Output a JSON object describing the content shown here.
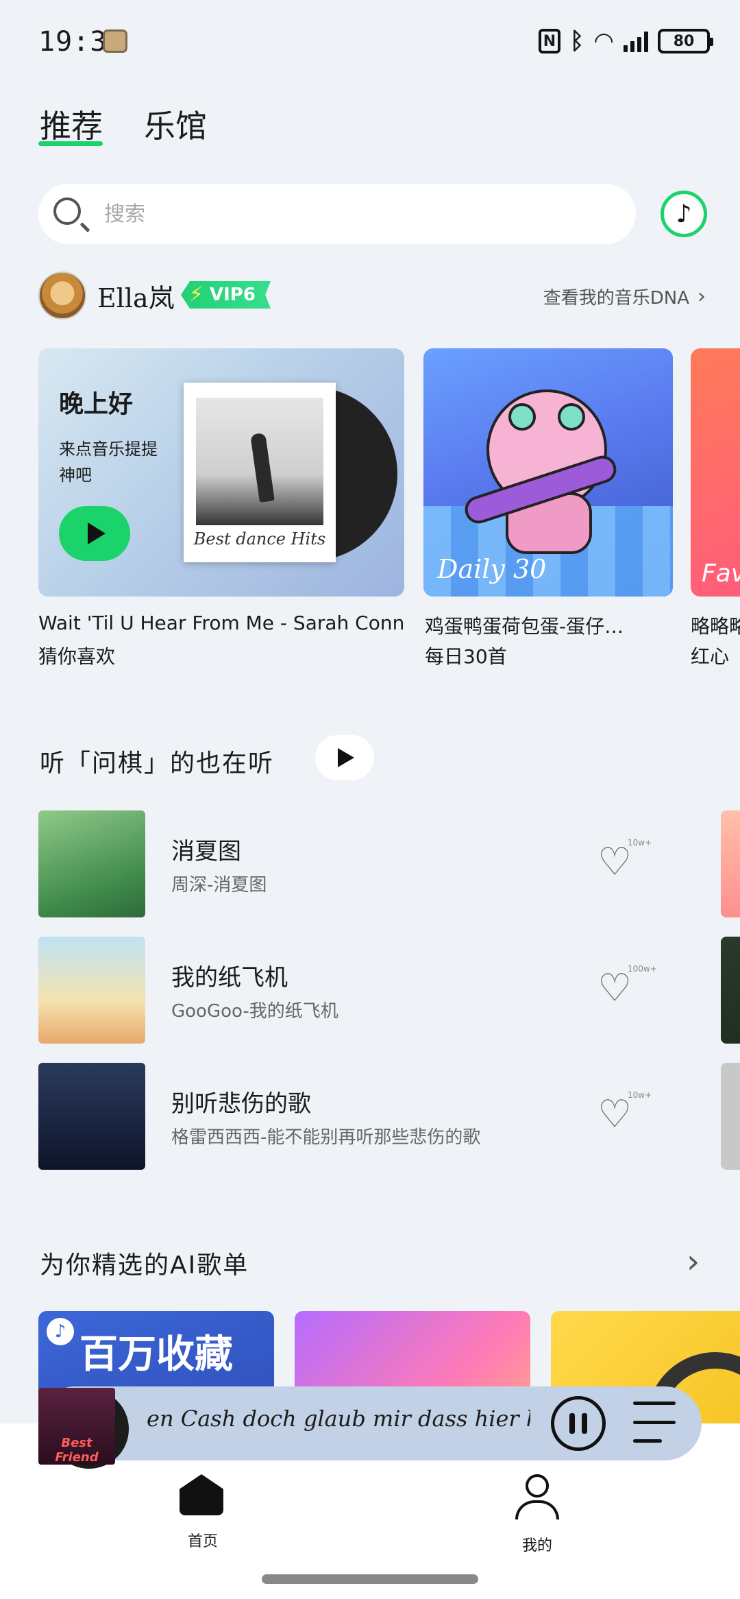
{
  "status_bar": {
    "time": "19:32",
    "battery": "80"
  },
  "tabs": [
    {
      "label": "推荐",
      "active": true
    },
    {
      "label": "乐馆",
      "active": false
    }
  ],
  "search": {
    "placeholder": "搜索"
  },
  "user": {
    "name": "Ella岚",
    "vip": "VIP6",
    "dna_link": "查看我的音乐DNA"
  },
  "cards": [
    {
      "greeting": "晚上好",
      "greeting_sub": "来点音乐提提神吧",
      "polaroid_caption": "Best dance Hits",
      "title": "Wait 'Til U Hear From Me - Sarah Connor",
      "subtitle": "猜你喜欢"
    },
    {
      "overlay": "Daily 30",
      "title": "鸡蛋鸭蛋荷包蛋-蛋仔…",
      "subtitle": "每日30首"
    },
    {
      "overlay": "Fav",
      "title": "略略略",
      "subtitle": "红心"
    }
  ],
  "section_listen": {
    "title": "听「问棋」的也在听"
  },
  "songs": [
    {
      "title": "消夏图",
      "artist": "周深-消夏图",
      "likes": "10w+"
    },
    {
      "title": "我的纸飞机",
      "artist": "GooGoo-我的纸飞机",
      "likes": "100w+"
    },
    {
      "title": "别听悲伤的歌",
      "artist": "格雷西西西-能不能别再听那些悲伤的歌",
      "likes": "10w+"
    }
  ],
  "section_ai": {
    "title": "为你精选的AI歌单",
    "playlists": [
      {
        "label": "百万收藏"
      }
    ]
  },
  "mini_player": {
    "lyric": "en Cash doch glaub mir dass hier keiner v",
    "cover_text": "Best Friend"
  },
  "bottom_nav": [
    {
      "label": "首页",
      "icon": "home-icon",
      "active": true
    },
    {
      "label": "我的",
      "icon": "person-icon",
      "active": false
    }
  ],
  "colors": {
    "accent": "#1ad36a",
    "background": "#eff3f7"
  }
}
